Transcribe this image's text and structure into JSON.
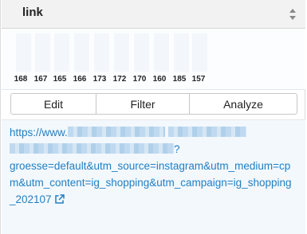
{
  "column": {
    "title": "link"
  },
  "histogram": {
    "values": [
      168,
      167,
      165,
      166,
      173,
      172,
      170,
      160,
      185,
      157
    ]
  },
  "actions": {
    "edit_label": "Edit",
    "filter_label": "Filter",
    "analyze_label": "Analyze"
  },
  "link": {
    "prefix": "https://www.",
    "question_mark": "?",
    "tail": "groesse=default&utm_source=instagram&utm_medium=cpm&utm_content=ig_shopping&utm_campaign=ig_shopping_202107"
  },
  "colors": {
    "header_bg": "#f2f2f2",
    "link": "#1f7fc4",
    "link_area_bg": "#f3f8fd"
  },
  "icons": {
    "sort": "sort-icon",
    "external": "external-link-icon"
  }
}
